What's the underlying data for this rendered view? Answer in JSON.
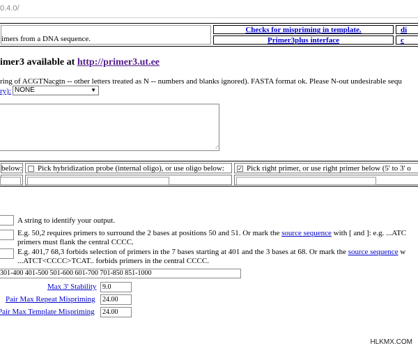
{
  "browser": {
    "url_fragment": "0.4.0/"
  },
  "header": {
    "description": "imers from a DNA sequence.",
    "link_mispriming": "Checks for mispriming in template.",
    "link_primer3plus": "Primer3plus interface",
    "right_top": "di",
    "right_bottom": "c"
  },
  "heading": {
    "prefix": "imer3 available at ",
    "link": "http://primer3.ut.ee"
  },
  "sequence": {
    "note": "ring of ACGTNacgtn -- other letters treated as N -- numbers and blanks ignored). FASTA format ok. Please N-out undesirable sequ",
    "mispriming_label": "ry):",
    "mispriming_selected": "NONE",
    "textarea_value": ""
  },
  "pick": {
    "left_label": "below:",
    "hyb_label": "Pick hybridization probe (internal oligo), or use oligo below:",
    "hyb_checked": false,
    "right_label": "Pick right primer, or use right primer below (5' to 3' o",
    "right_checked": true
  },
  "form": {
    "name_desc": "A string to identify your output.",
    "target_desc_1": "E.g. 50,2 requires primers to surround the 2 bases at positions 50 and 51. Or mark the ",
    "target_link": "source sequence",
    "target_desc_2": " with [ and ]: e.g. ...ATC",
    "target_desc_line2": "primers must flank the central CCCC.",
    "excluded_desc_1": "E.g. 401,7 68,3 forbids selection of primers in the 7 bases starting at 401 and the 3 bases at 68. Or mark the ",
    "excluded_link": "source sequence",
    "excluded_desc_2": " w",
    "excluded_desc_line2": "...ATCT<CCCC>TCAT.. forbids primers in the central CCCC.",
    "excluded_regions_value": "301-400 401-500 501-600 601-700 701-850 851-1000",
    "max3_label": "Max 3' Stability",
    "max3_value": "9.0",
    "pair_repeat_label": "Pair Max Repeat Mispriming",
    "pair_repeat_value": "24.00",
    "pair_template_label": "Pair Max Template Mispriming",
    "pair_template_value": "24.00"
  },
  "watermark": "HLKMX.COM"
}
